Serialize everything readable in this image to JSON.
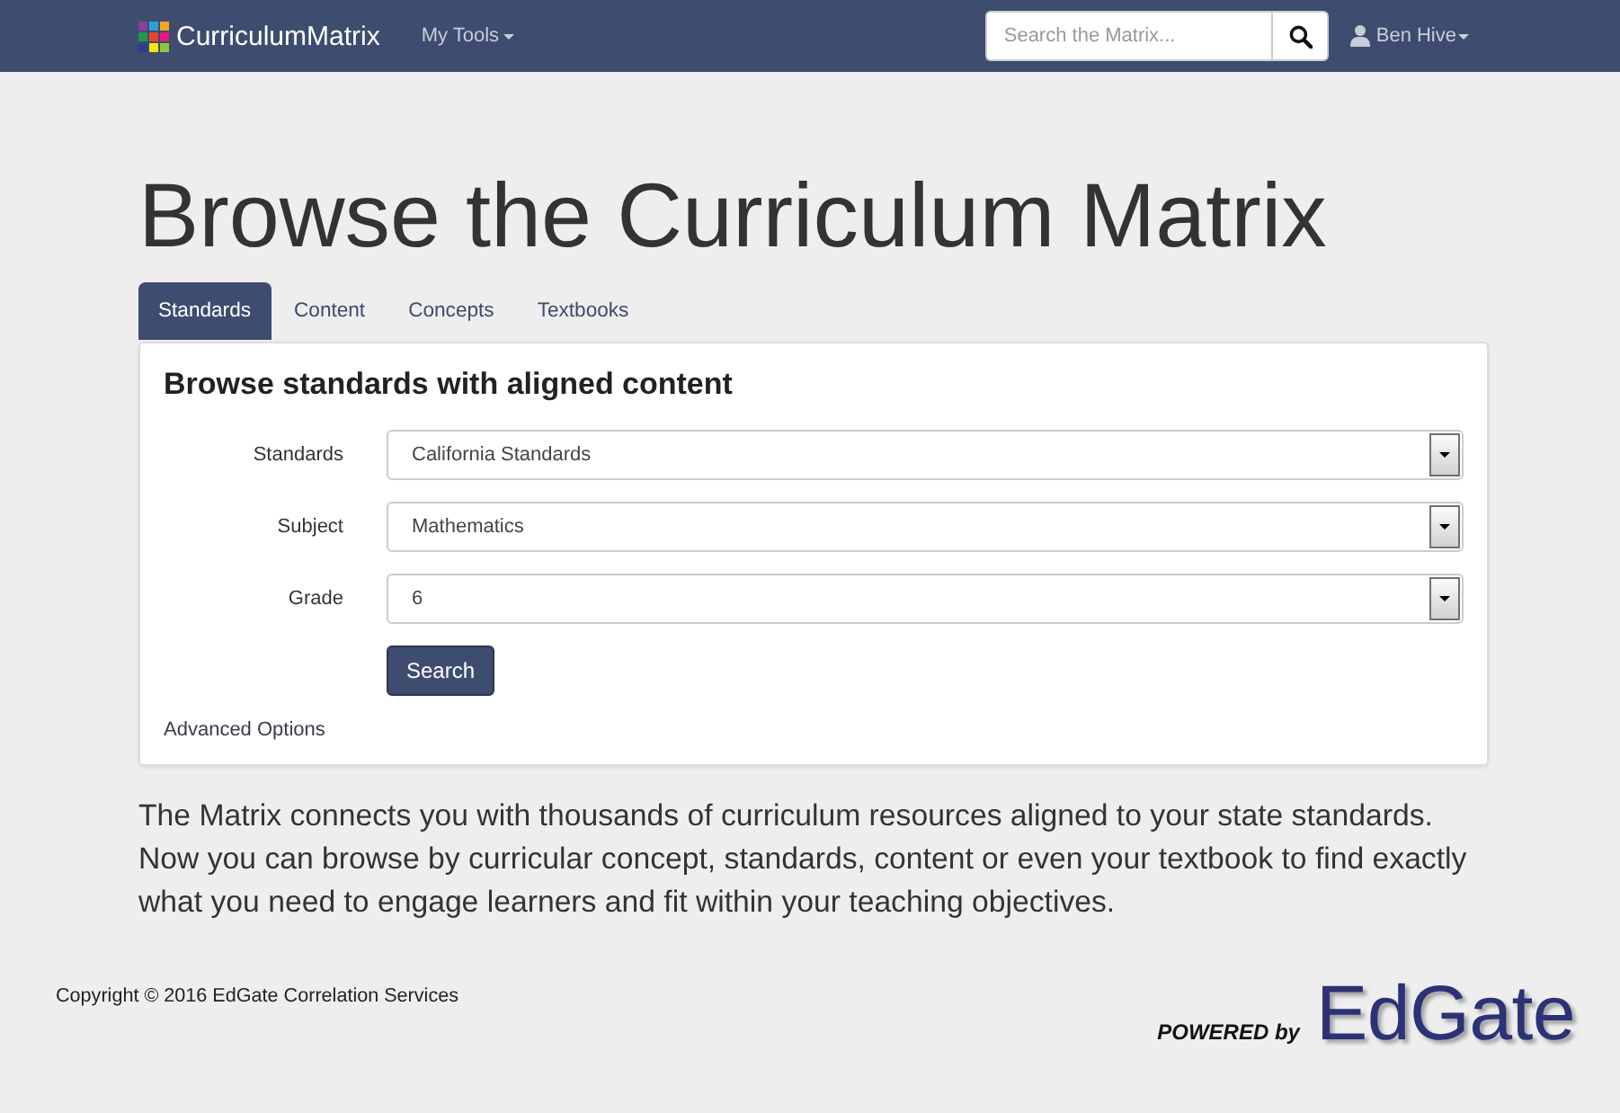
{
  "navbar": {
    "brand": "CurriculumMatrix",
    "menu": "My Tools",
    "search": {
      "placeholder": "Search the Matrix..."
    },
    "user": "Ben Hive"
  },
  "heading": "Browse the Curriculum Matrix",
  "tabs": [
    {
      "label": "Standards",
      "selected": true
    },
    {
      "label": "Content",
      "selected": false
    },
    {
      "label": "Concepts",
      "selected": false
    },
    {
      "label": "Textbooks",
      "selected": false
    }
  ],
  "panel": {
    "title": "Browse standards with aligned content",
    "fields": [
      {
        "label": "Standards",
        "value": "California Standards"
      },
      {
        "label": "Subject",
        "value": "Mathematics"
      },
      {
        "label": "Grade",
        "value": "6"
      }
    ],
    "button": "Search",
    "link": "Advanced Options"
  },
  "intro": "The Matrix connects you with thousands of curriculum resources aligned to your state standards. Now you can browse by curricular concept, standards, content or even your textbook to find exactly what you need to engage learners and fit within your teaching objectives.",
  "footer": {
    "copyright": "Copyright © 2016 EdGate Correlation Services",
    "powered_by": "POWERED by",
    "logo": "EdGate"
  }
}
